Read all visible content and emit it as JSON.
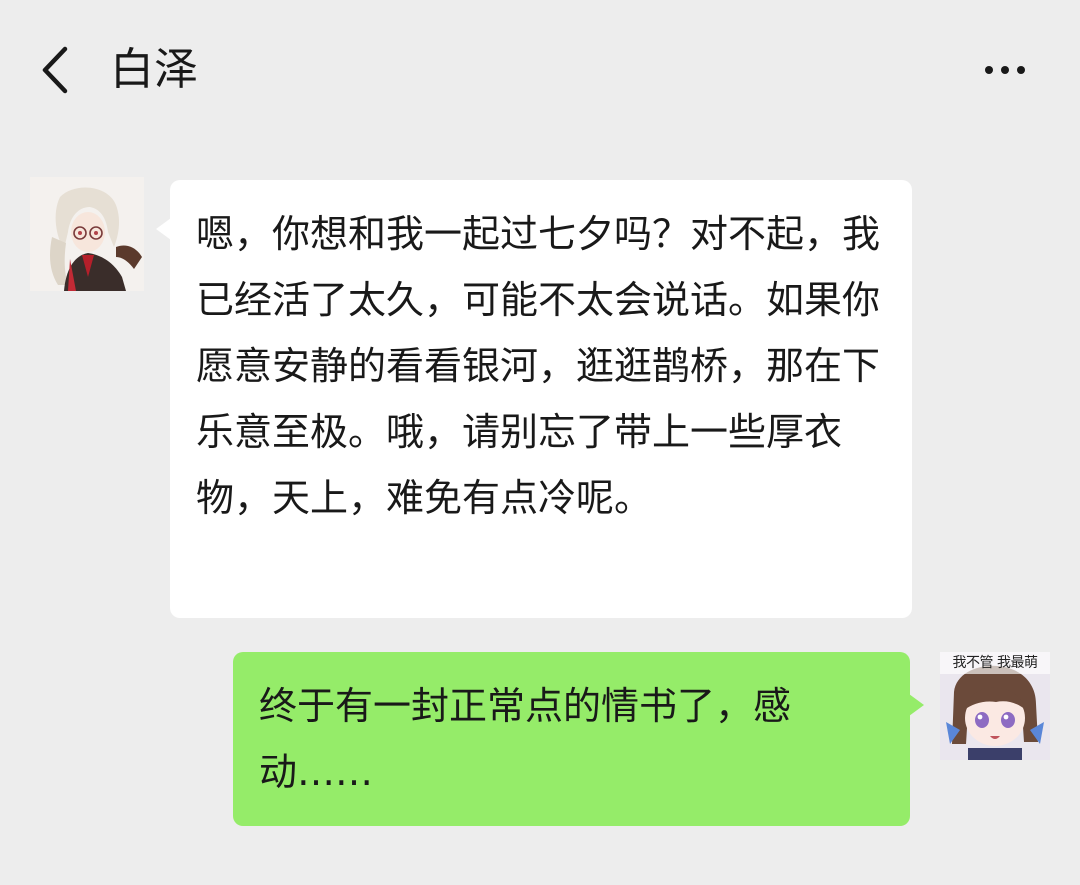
{
  "header": {
    "title": "白泽",
    "back_icon": "chevron-left-icon",
    "more_icon": "more-dots-icon"
  },
  "messages": [
    {
      "sender": "contact",
      "text": "嗯，你想和我一起过七夕吗？对不起，我已经活了太久，可能不太会说话。如果你愿意安静的看看银河，逛逛鹊桥，那在下乐意至极。哦，请别忘了带上一些厚衣物，天上，难免有点冷呢。"
    },
    {
      "sender": "me",
      "text": "终于有一封正常点的情书了，感动……",
      "avatar_caption": "我不管 我最萌"
    }
  ],
  "colors": {
    "background": "#ededed",
    "incoming_bubble": "#ffffff",
    "outgoing_bubble": "#95ec69",
    "text": "#191919"
  }
}
